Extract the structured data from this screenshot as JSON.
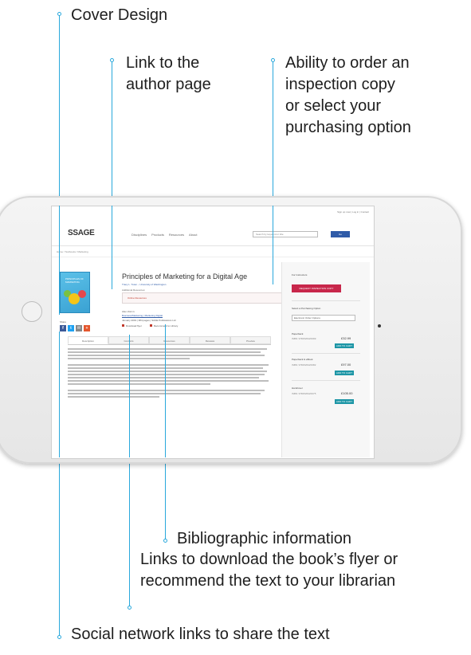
{
  "callouts": {
    "cover_design": "Cover Design",
    "author_link_l1": "Link to the",
    "author_link_l2": "author page",
    "order_l1": "Ability to order an",
    "order_l2": "inspection copy",
    "order_l3": "or select your",
    "order_l4": "purchasing option",
    "biblio": "Bibliographic information",
    "download_l1": "Links to download the book’s flyer or",
    "download_l2": "recommend the text to your librarian",
    "social": "Social network links to share the text"
  },
  "screen": {
    "logo": "SSAGE",
    "top_nav": "Sign up now  |  Log in  |  Contact",
    "menu": [
      "Disciplines",
      "Products",
      "Resources",
      "About"
    ],
    "search_placeholder": "Search by keyword or title",
    "go": "Go",
    "breadcrumb": "Home / Textbooks / Marketing",
    "cover_title": "PRINCIPLES OF MARKETING",
    "book_title": "Principles of Marketing for a Digital Age",
    "authors": "Tracy L. Tuten – University of Washington",
    "additional_resources": "Additional Resources:",
    "resources_box": "Online Resources",
    "also_by": "Also Visit in:",
    "also_by_links": "Business/Marketing  |  Marketing Digital",
    "biblio_line": "January 2019 | 384 pages | SAGE Publications Ltd",
    "link_flyer": "Download flyer",
    "link_librarian": "Recommend to Library",
    "share": "Share",
    "tabs": [
      "Description",
      "Contents",
      "Resources",
      "Reviews",
      "Preview"
    ],
    "side": {
      "instructors": "For Instructors",
      "inspection_button": "REQUEST INSPECTION COPY",
      "purchasing": "Select a Purchasing Option",
      "select_value": "Electronic Order Options",
      "pb_label": "Paperback",
      "pb_isbn": "ISBN: 9781526423399",
      "pb_price": "£32.99",
      "hb_label": "Paperback & eBook",
      "hb_isbn": "ISBN: 9781526423382",
      "hb_price": "£97.00",
      "eb_label": "Hardcover",
      "eb_isbn": "ISBN: 9781526423375",
      "eb_price": "£105.00",
      "add_to_cart": "ADD TO CART"
    }
  },
  "colors": {
    "callout_line": "#29a8dc",
    "brand_blue": "#2f5ba8",
    "accent_red": "#c8274b",
    "teal": "#1d96a6"
  }
}
